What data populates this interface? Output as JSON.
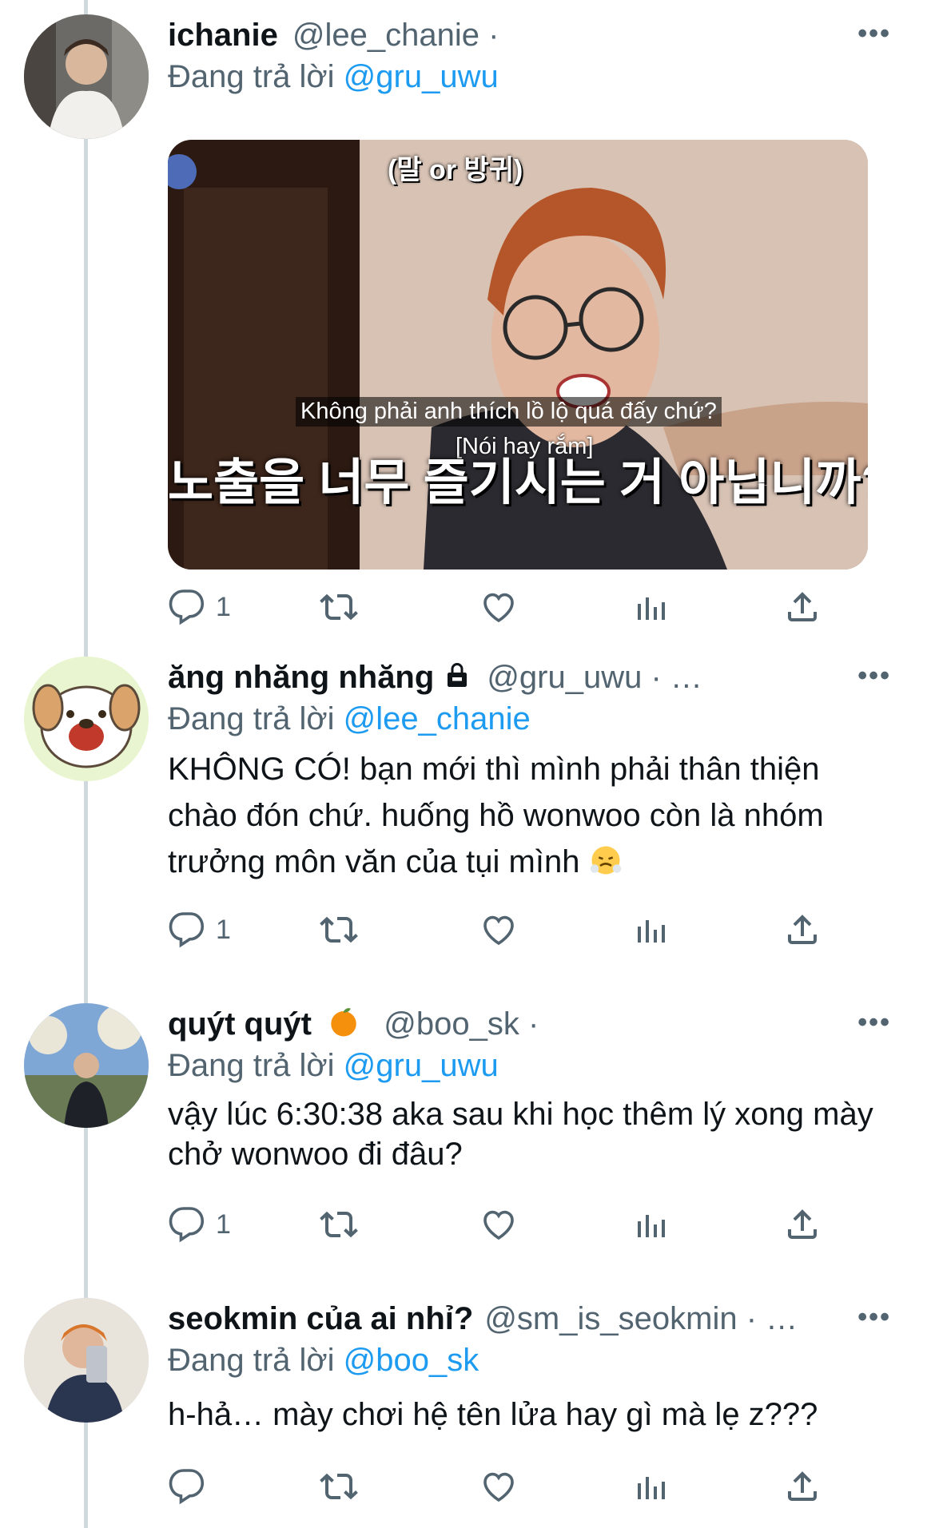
{
  "tweets": [
    {
      "name": "ichanie",
      "handle": "@lee_chanie",
      "sep": "·",
      "reply_prefix": "Đang trả lời",
      "reply_to": "@gru_uwu",
      "more": "•••",
      "media": {
        "top_caption": "(말 or 방귀)",
        "sub_vi": "Không phải anh thích lồ lộ quá đấy chứ?",
        "sub_note": "[Nói hay rắm]",
        "sub_ko": "노출을 너무 즐기시는 거 아닙니까?"
      },
      "stats": {
        "replies": "1"
      }
    },
    {
      "name": "ăng nhăng nhăng",
      "handle": "@gru_uwu",
      "sep": "· …",
      "reply_prefix": "Đang trả lời",
      "reply_to": "@lee_chanie",
      "more": "•••",
      "text": "KHÔNG CÓ! bạn mới thì mình phải thân thiện chào đón chứ. huống hồ wonwoo còn là nhóm trưởng môn văn của tụi mình",
      "emoji": "face-with-steam-emoji",
      "stats": {
        "replies": "1"
      }
    },
    {
      "name": "quýt quýt",
      "handle": "@boo_sk",
      "sep": "·",
      "reply_prefix": "Đang trả lời",
      "reply_to": "@gru_uwu",
      "more": "•••",
      "text": "vậy lúc 6:30:38 aka sau khi học thêm lý xong mày chở wonwoo đi đâu?",
      "emoji": "tangerine-emoji",
      "stats": {
        "replies": "1"
      }
    },
    {
      "name": "seokmin của ai nhỉ?",
      "handle": "@sm_is_seokmin",
      "sep": "· …",
      "reply_prefix": "Đang trả lời",
      "reply_to": "@boo_sk",
      "more": "•••",
      "text": "h-hả… mày chơi hệ tên lửa hay gì mà lẹ z???",
      "stats": {
        "replies": ""
      }
    }
  ],
  "colors": {
    "accent": "#1d9bf0",
    "muted": "#536471",
    "text": "#0f1419",
    "thread": "#cfd9de"
  },
  "icons": [
    "reply-icon",
    "retweet-icon",
    "like-icon",
    "analytics-icon",
    "share-icon",
    "lock-icon",
    "more-icon"
  ]
}
